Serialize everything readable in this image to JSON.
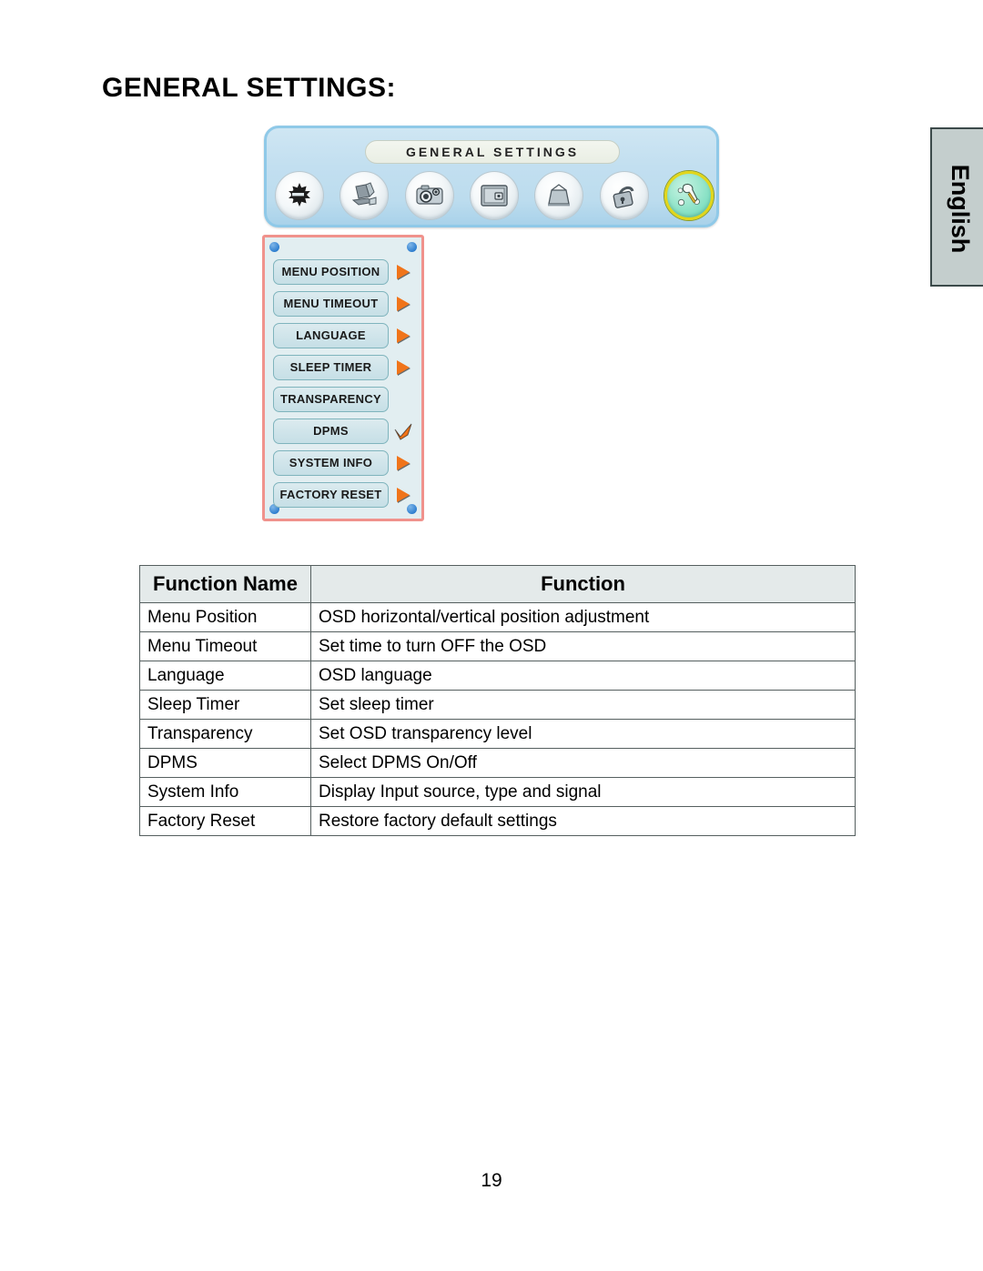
{
  "page": {
    "title": "GENERAL SETTINGS:",
    "number": "19",
    "language_tab": "English"
  },
  "osd": {
    "title_plate": "GENERAL SETTINGS",
    "icons": [
      {
        "name": "brightness-contrast-icon",
        "label": "Brightness / Contrast",
        "selected": false
      },
      {
        "name": "computer-auto-adjust-icon",
        "label": "Auto Adjust",
        "selected": false
      },
      {
        "name": "color-camera-icon",
        "label": "Color Settings",
        "selected": false
      },
      {
        "name": "picture-screen-icon",
        "label": "Picture Settings",
        "selected": false
      },
      {
        "name": "geometry-trapezoid-icon",
        "label": "Geometry",
        "selected": false
      },
      {
        "name": "osd-lock-icon",
        "label": "OSD Lock",
        "selected": false
      },
      {
        "name": "general-settings-tools-icon",
        "label": "General Settings",
        "selected": true
      }
    ],
    "selected_ring_color": "#e2d61a",
    "selected_fill_color": "#62d6b6",
    "panel_border_color": "#f0928c",
    "menu_items": [
      {
        "label": "MENU POSITION",
        "marker": "arrow-right"
      },
      {
        "label": "MENU TIMEOUT",
        "marker": "arrow-right"
      },
      {
        "label": "LANGUAGE",
        "marker": "arrow-right"
      },
      {
        "label": "SLEEP TIMER",
        "marker": "arrow-right"
      },
      {
        "label": "TRANSPARENCY",
        "marker": "none"
      },
      {
        "label": "DPMS",
        "marker": "check-arrow"
      },
      {
        "label": "SYSTEM INFO",
        "marker": "arrow-right"
      },
      {
        "label": "FACTORY RESET",
        "marker": "arrow-right"
      }
    ],
    "marker_color": "#f0741a"
  },
  "table": {
    "headers": [
      "Function Name",
      "Function"
    ],
    "rows": [
      [
        "Menu Position",
        "OSD horizontal/vertical position adjustment"
      ],
      [
        "Menu Timeout",
        "Set time to turn OFF the OSD"
      ],
      [
        "Language",
        "OSD language"
      ],
      [
        "Sleep Timer",
        "Set sleep timer"
      ],
      [
        "Transparency",
        "Set OSD transparency level"
      ],
      [
        "DPMS",
        "Select DPMS On/Off"
      ],
      [
        "System Info",
        "Display Input source, type and signal"
      ],
      [
        "Factory Reset",
        "Restore factory default settings"
      ]
    ]
  }
}
